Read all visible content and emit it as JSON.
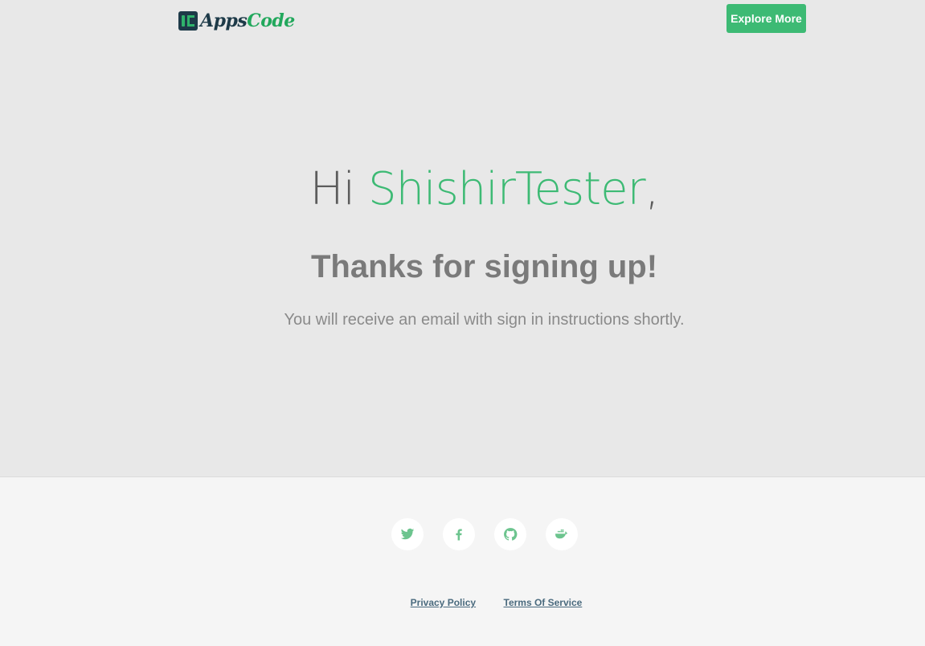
{
  "header": {
    "logo": {
      "apps": "Apps",
      "code": "Code"
    },
    "explore_label": "Explore More"
  },
  "main": {
    "greeting_prefix": "Hi ",
    "username": "ShishirTester",
    "greeting_suffix": ",",
    "thanks": "Thanks for signing up!",
    "info": "You will receive an email with sign in instructions shortly."
  },
  "footer": {
    "social": [
      {
        "icon": "twitter-icon"
      },
      {
        "icon": "facebook-icon"
      },
      {
        "icon": "github-icon"
      },
      {
        "icon": "docker-icon"
      }
    ],
    "links": {
      "privacy": "Privacy Policy",
      "terms": "Terms Of Service"
    }
  },
  "colors": {
    "accent": "#3dba74",
    "hero_bg": "#e8e8e8",
    "footer_bg": "#f5f5f5",
    "logo_dark": "#1d3a48"
  }
}
